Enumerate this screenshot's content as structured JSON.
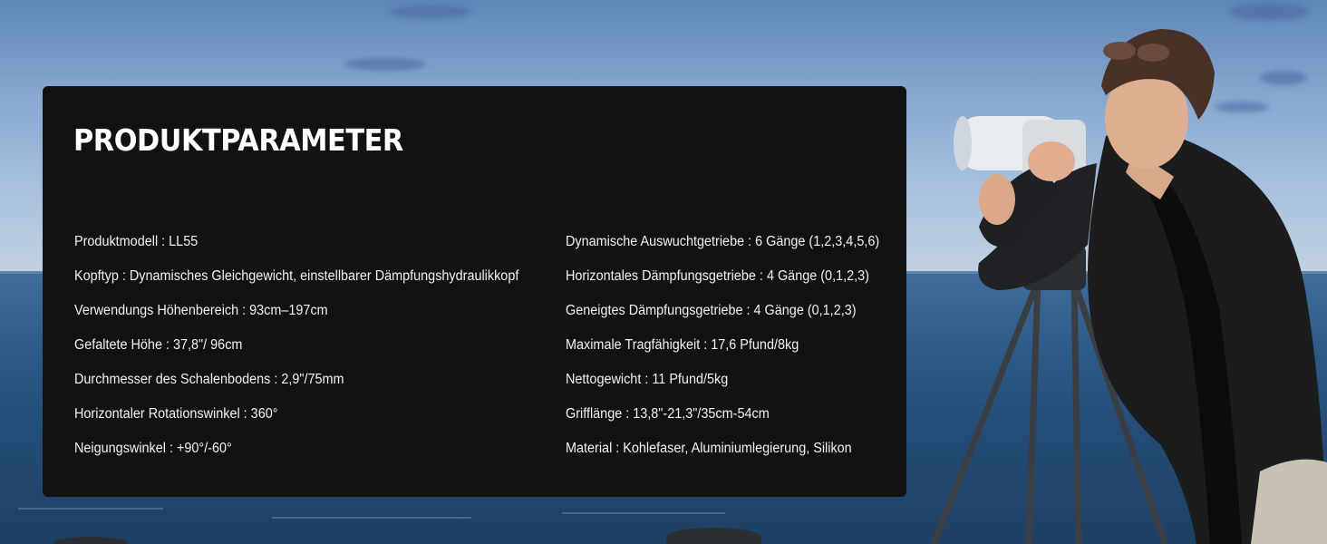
{
  "panel": {
    "title": "PRODUKTPARAMETER",
    "left_specs": [
      "Produktmodell : LL55",
      "Kopftyp : Dynamisches Gleichgewicht, einstellbarer Dämpfungshydraulikkopf",
      "Verwendungs Höhenbereich : 93cm–197cm",
      "Gefaltete Höhe : 37,8\"/ 96cm",
      "Durchmesser des Schalenbodens : 2,9\"/75mm",
      "Horizontaler Rotationswinkel : 360°",
      "Neigungswinkel : +90°/-60°"
    ],
    "right_specs": [
      "Dynamische Auswuchtgetriebe : 6 Gänge (1,2,3,4,5,6)",
      "Horizontales Dämpfungsgetriebe : 4 Gänge (0,1,2,3)",
      "Geneigtes Dämpfungsgetriebe : 4 Gänge (0,1,2,3)",
      "Maximale Tragfähigkeit : 17,6 Pfund/8kg",
      "Nettogewicht : 11 Pfund/5kg",
      "Grifflänge : 13,8\"-21,3\"/35cm-54cm",
      "Material : Kohlefaser, Aluminiumlegierung, Silikon"
    ]
  },
  "colors": {
    "panel_background": "#121212",
    "text": "#ffffff",
    "sky": "#87a8d0",
    "sea": "#2d5a88"
  }
}
